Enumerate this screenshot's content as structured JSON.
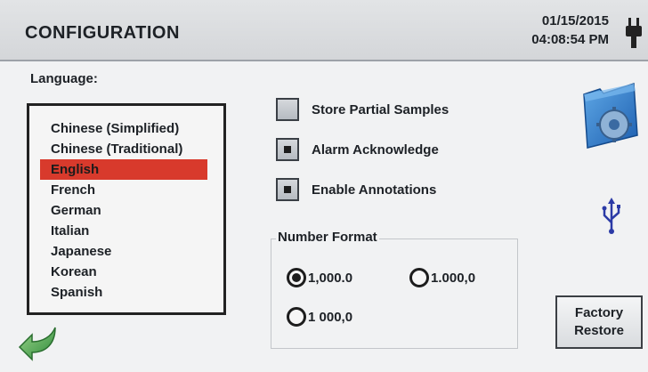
{
  "header": {
    "title": "CONFIGURATION",
    "date": "01/15/2015",
    "time": "04:08:54 PM",
    "power_icon": "plug-icon"
  },
  "language": {
    "label": "Language:",
    "items": [
      "Chinese (Simplified)",
      "Chinese (Traditional)",
      "English",
      "French",
      "German",
      "Italian",
      "Japanese",
      "Korean",
      "Spanish"
    ],
    "selected": "English",
    "selected_color": "#d83a2c"
  },
  "options": [
    {
      "label": "Store Partial Samples",
      "checked": false
    },
    {
      "label": "Alarm Acknowledge",
      "checked": true
    },
    {
      "label": "Enable Annotations",
      "checked": true
    }
  ],
  "number_format": {
    "title": "Number Format",
    "choices": [
      {
        "label": "1,000.0",
        "selected": true
      },
      {
        "label": "1.000,0",
        "selected": false
      },
      {
        "label": "1 000,0",
        "selected": false
      }
    ]
  },
  "icons": {
    "settings": "folder-gear-icon",
    "usb": "usb-icon",
    "back": "back-arrow-icon"
  },
  "factory_restore": {
    "line1": "Factory",
    "line2": "Restore"
  }
}
